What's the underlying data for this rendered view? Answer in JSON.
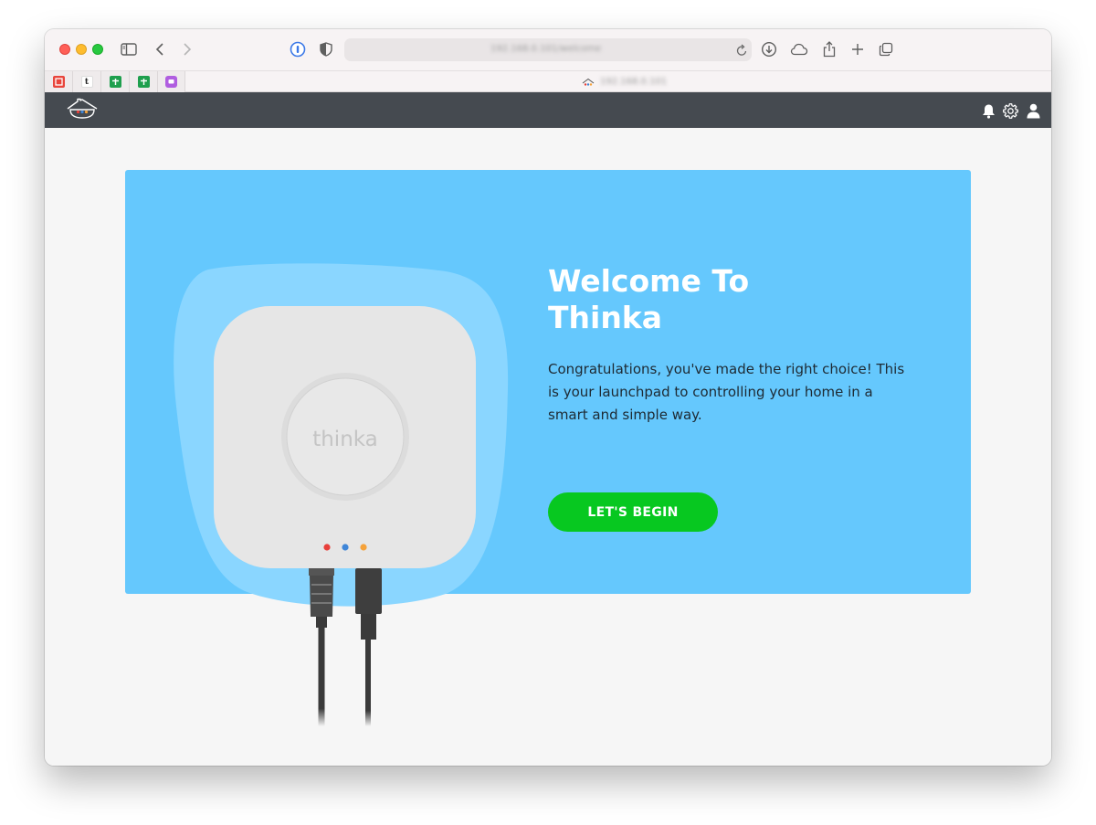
{
  "browser": {
    "address": "192.168.0.101/welcome",
    "active_tab_title": "192.168.0.101",
    "pinned_tabs": [
      {
        "icon": "office-icon",
        "color": "#e8453c",
        "glyph": "O"
      },
      {
        "icon": "t-icon",
        "color": "#222222",
        "glyph": "t"
      },
      {
        "icon": "sheets-icon",
        "color": "#1e9f4d",
        "glyph": "+"
      },
      {
        "icon": "sheets-icon",
        "color": "#1e9f4d",
        "glyph": "+"
      },
      {
        "icon": "chat-icon",
        "color": "#b05ee0",
        "glyph": "▢"
      }
    ]
  },
  "hero": {
    "title": "Welcome To Thinka",
    "description": "Congratulations, you've made the right choice! This is your launchpad to controlling your home in a smart and simple way.",
    "button_label": "LET'S BEGIN",
    "device_brand": "thinka"
  },
  "colors": {
    "header_bg": "#454a50",
    "hero_bg": "#65c8fd",
    "button_bg": "#07c820",
    "led_red": "#e8403b",
    "led_blue": "#3f86d8",
    "led_orange": "#f5a23a"
  }
}
